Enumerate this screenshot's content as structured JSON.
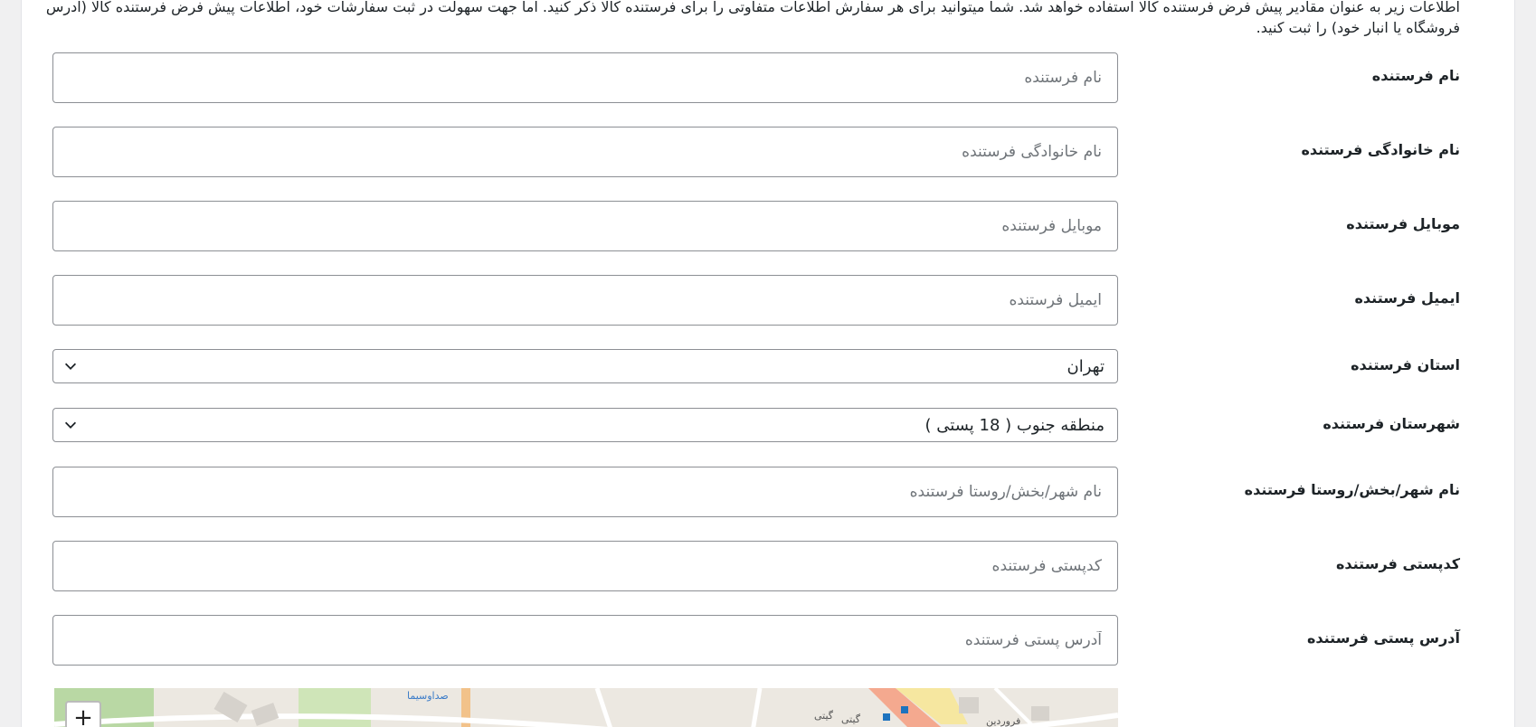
{
  "intro_text": "اطلاعات زیر به عنوان مقادیر پیش فرض فرستنده کالا استفاده خواهد شد. شما میتوانید برای هر سفارش اطلاعات متفاوتی را برای فرستنده کالا ذکر کنید. اما جهت سهولت در ثبت سفارشات خود، اطلاعات پیش فرض فرستنده کالا (آدرس فروشگاه یا انبار خود) را ثبت کنید.",
  "fields": {
    "first_name": {
      "label": "نام فرستنده",
      "placeholder": "نام فرستنده",
      "value": ""
    },
    "last_name": {
      "label": "نام خانوادگی فرستنده",
      "placeholder": "نام خانوادگی فرستنده",
      "value": ""
    },
    "mobile": {
      "label": "موبایل فرستنده",
      "placeholder": "موبایل فرستنده",
      "value": ""
    },
    "email": {
      "label": "ایمیل فرستنده",
      "placeholder": "ایمیل فرستنده",
      "value": ""
    },
    "province": {
      "label": "استان فرستنده",
      "selected": "تهران"
    },
    "county": {
      "label": "شهرستان فرستنده",
      "selected": "منطقه جنوب ( 18 پستی )"
    },
    "city": {
      "label": "نام شهر/بخش/روستا فرستنده",
      "placeholder": "نام شهر/بخش/روستا فرستنده",
      "value": ""
    },
    "postcode": {
      "label": "کدپستی فرستنده",
      "placeholder": "کدپستی فرستنده",
      "value": ""
    },
    "address": {
      "label": "آدرس پستی فرستنده",
      "placeholder": "آدرس پستی فرستنده",
      "value": ""
    }
  },
  "map": {
    "zoom_in_label": "+",
    "labels": [
      "صداوسیما",
      "گیتی",
      "گیتی",
      "فروردین"
    ]
  }
}
